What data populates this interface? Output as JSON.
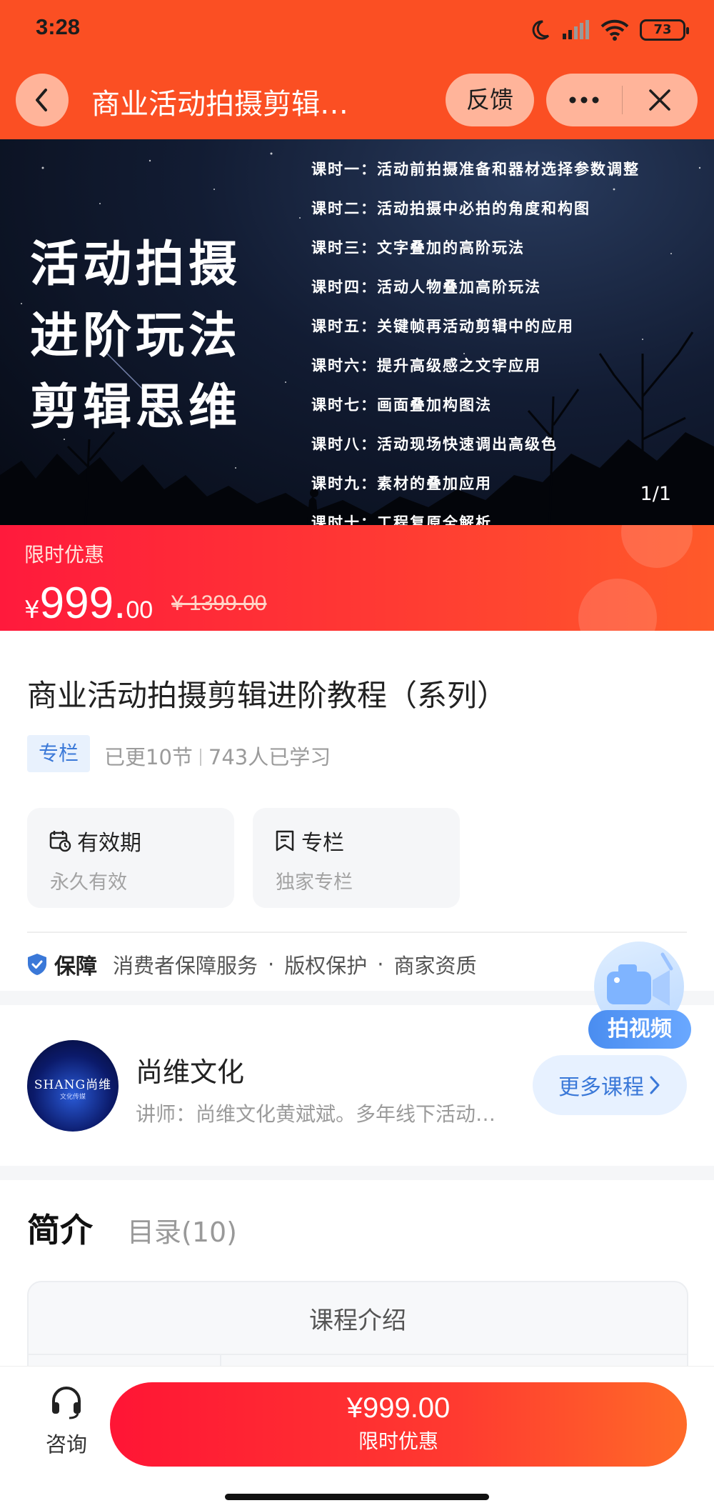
{
  "status_bar": {
    "time": "3:28",
    "battery": "73"
  },
  "nav": {
    "title": "商业活动拍摄剪辑…",
    "feedback_label": "反馈"
  },
  "banner": {
    "headline": [
      "活动拍摄",
      "进阶玩法",
      "剪辑思维"
    ],
    "lessons": [
      "课时一：活动前拍摄准备和器材选择参数调整",
      "课时二：活动拍摄中必拍的角度和构图",
      "课时三：文字叠加的高阶玩法",
      "课时四：活动人物叠加高阶玩法",
      "课时五：关键帧再活动剪辑中的应用",
      "课时六：提升高级感之文字应用",
      "课时七：画面叠加构图法",
      "课时八：活动现场快速调出高级色",
      "课时九：素材的叠加应用",
      "课时十：工程复原全解析"
    ],
    "page_indicator": "1/1"
  },
  "price": {
    "promo_label": "限时优惠",
    "currency": "¥",
    "integer": "999.",
    "decimal": "00",
    "original": "¥ 1399.00"
  },
  "course": {
    "title": "商业活动拍摄剪辑进阶教程（系列）",
    "tag": "专栏",
    "updated": "已更10节",
    "learners": "743人已学习"
  },
  "cards": [
    {
      "title": "有效期",
      "sub": "永久有效",
      "icon": "calendar-clock-icon"
    },
    {
      "title": "专栏",
      "sub": "独家专栏",
      "icon": "bookmark-icon"
    }
  ],
  "guarantee": {
    "title": "保障",
    "items": [
      "消费者保障服务",
      "版权保护",
      "商家资质"
    ],
    "icon": "shield-check-icon"
  },
  "float_video": {
    "label": "拍视频"
  },
  "author": {
    "avatar_text": "SHANG尚维",
    "avatar_subtext": "文化传媒",
    "name": "尚维文化",
    "desc": "讲师：尚维文化黄斌斌。多年线下活动…",
    "more_label": "更多课程"
  },
  "tabs": {
    "intro": "简介",
    "catalog": "目录(10)"
  },
  "intro_box": {
    "title": "课程介绍"
  },
  "bottom_bar": {
    "consult_label": "咨询",
    "buy_price": "¥999.00",
    "buy_label": "限时优惠"
  },
  "colors": {
    "brand": "#fb4f23",
    "price_red": "#ff1a3c",
    "accent_blue": "#3a78d8"
  }
}
